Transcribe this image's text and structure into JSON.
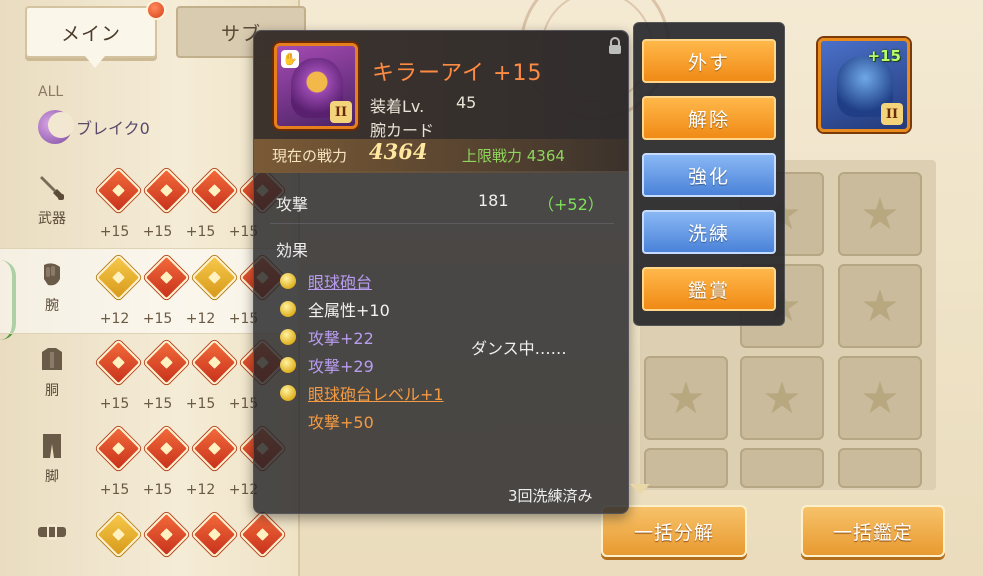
{
  "tabs": {
    "main": "メイン",
    "sub": "サブ"
  },
  "filter": {
    "all": "ALL",
    "break": "ブレイク0"
  },
  "categories": [
    {
      "label": "武器",
      "icon": "sword-icon",
      "levels": [
        "+15",
        "+15",
        "+15",
        "+15"
      ],
      "card_colors": [
        "red",
        "red",
        "red",
        "red"
      ]
    },
    {
      "label": "腕",
      "icon": "gauntlet-icon",
      "levels": [
        "+12",
        "+15",
        "+12",
        "+15"
      ],
      "card_colors": [
        "gold",
        "red",
        "gold",
        "red"
      ]
    },
    {
      "label": "胴",
      "icon": "armor-icon",
      "levels": [
        "+15",
        "+15",
        "+15",
        "+15"
      ],
      "card_colors": [
        "red",
        "red",
        "red",
        "red"
      ]
    },
    {
      "label": "脚",
      "icon": "pants-icon",
      "levels": [
        "+15",
        "+15",
        "+12",
        "+12"
      ],
      "card_colors": [
        "red",
        "red",
        "red",
        "red"
      ]
    },
    {
      "label": "",
      "icon": "belt-icon",
      "levels": [],
      "card_colors": [
        "gold",
        "red",
        "red",
        "red"
      ]
    }
  ],
  "tooltip": {
    "item_name": "キラーアイ +15",
    "equip_lv_label": "装着Lv.",
    "equip_lv_value": "45",
    "item_type": "腕カード",
    "rank": "II",
    "current_power_label": "現在の戦力",
    "current_power": "4364",
    "max_power": "上限戦力 4364",
    "attack_label": "攻撃",
    "attack_value": "181",
    "attack_bonus": "（+52）",
    "effects_label": "効果",
    "effects": [
      {
        "text": "眼球砲台",
        "style": "purple-u"
      },
      {
        "text": "全属性+10",
        "style": "white"
      },
      {
        "text": "攻撃+22",
        "style": "purple"
      },
      {
        "text": "攻撃+29",
        "style": "purple"
      },
      {
        "text": "眼球砲台レベル+1",
        "style": "orange-u"
      }
    ],
    "effect_sub": "攻撃+50",
    "dance_status": "ダンス中……",
    "refine_count": "3回洗練済み"
  },
  "actions": {
    "remove": "外す",
    "release": "解除",
    "enhance": "強化",
    "refine": "洗練",
    "appraise": "鑑賞"
  },
  "hero": {
    "level": "+15",
    "rank": "II"
  },
  "bottom": {
    "bulk_disassemble": "一括分解",
    "bulk_appraise": "一括鑑定"
  },
  "colors": {
    "accent_orange": "#f08a16",
    "accent_blue": "#4a82d8",
    "power_green": "#8fd65c",
    "item_name": "#ff8a42"
  }
}
